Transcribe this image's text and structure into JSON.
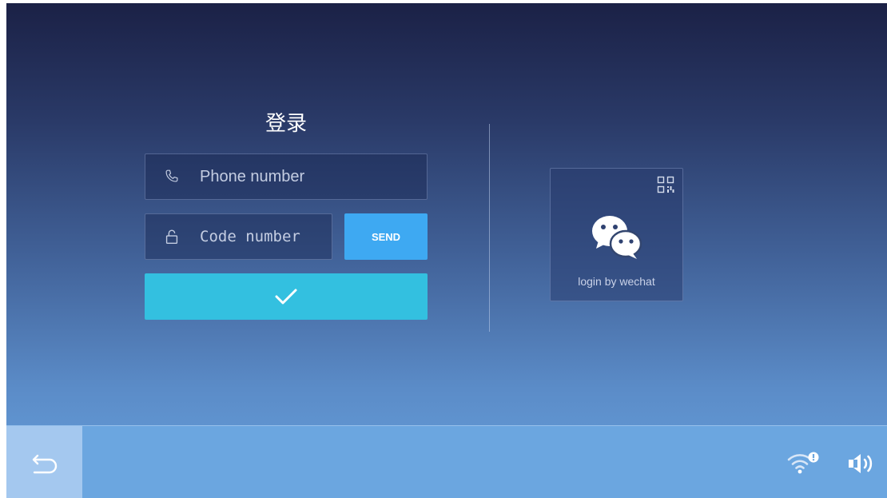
{
  "login": {
    "title": "登录",
    "phone_placeholder": "Phone number",
    "code_placeholder": "Code number",
    "send_label": "SEND",
    "confirm_icon": "check-icon"
  },
  "wechat": {
    "label": "login by wechat",
    "qr_icon": "qr-code-icon",
    "icon": "wechat-icon"
  },
  "status_bar": {
    "back_icon": "back-arrow-icon",
    "wifi_icon": "wifi-warning-icon",
    "volume_icon": "volume-icon"
  },
  "colors": {
    "send_button": "#3ea9f2",
    "confirm_button": "#33c0e0",
    "back_button": "#a4c8ef",
    "bottom_bar": "#6ba6e0"
  }
}
